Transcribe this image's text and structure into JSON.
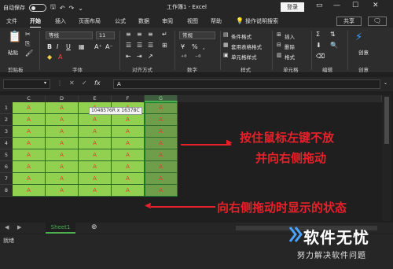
{
  "titlebar": {
    "autosave": "自动保存",
    "toggle_state": "关",
    "title": "工作簿1 - Excel",
    "login": "登录"
  },
  "tabs": [
    "文件",
    "开始",
    "插入",
    "页面布局",
    "公式",
    "数据",
    "审阅",
    "视图",
    "帮助",
    "操作说明搜索"
  ],
  "share": "共享",
  "ribbon": {
    "paste": "粘贴",
    "clipboard": "剪贴板",
    "font_name": "等线",
    "font_size": "11",
    "font_group": "字体",
    "align_group": "对齐方式",
    "number_format": "常规",
    "number_group": "数字",
    "cond_format": "条件格式",
    "table_format": "套用表格格式",
    "cell_style": "单元格样式",
    "styles_group": "样式",
    "insert": "插入",
    "delete": "删除",
    "format": "格式",
    "cells_group": "单元格",
    "edit_group": "编辑",
    "create": "创意",
    "create_group": "创意"
  },
  "formula_bar": {
    "value": "A"
  },
  "grid": {
    "columns": [
      "C",
      "D",
      "E",
      "F",
      "G"
    ],
    "selected_column": "G",
    "rows": [
      "1",
      "2",
      "3",
      "4",
      "5",
      "6",
      "7",
      "8"
    ],
    "cell_value": "A",
    "tooltip": "1048576R x 16378C"
  },
  "annotations": {
    "line1": "按住鼠标左键不放",
    "line2": "并向右侧拖动",
    "line3": "向右侧拖动时显示的状态"
  },
  "sheet": {
    "tab": "Sheet1"
  },
  "status": {
    "ready": "就绪"
  },
  "watermark": {
    "title": "软件无忧",
    "subtitle": "努力解决软件问题"
  },
  "colors": {
    "cell_fill": "#92d050",
    "cell_text": "#ff2a2a",
    "annotation": "#e8202a",
    "accent_green": "#4caf50"
  }
}
